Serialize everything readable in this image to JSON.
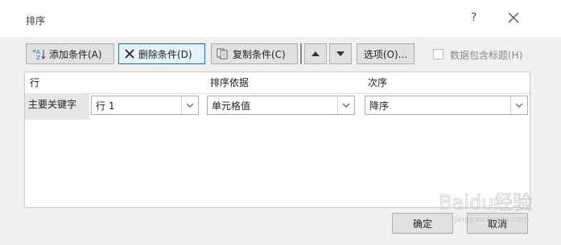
{
  "window": {
    "title": "排序",
    "help_label": "?"
  },
  "toolbar": {
    "add_label": "添加条件(A)",
    "delete_label": "删除条件(D)",
    "copy_label": "复制条件(C)",
    "options_label": "选项(O)...",
    "header_checkbox_label": "数据包含标题(H)",
    "header_checkbox_checked": false
  },
  "grid": {
    "columns": [
      "行",
      "排序依据",
      "次序"
    ],
    "rows": [
      {
        "key_label": "主要关键字",
        "row_value": "行 1",
        "sort_on": "单元格值",
        "order": "降序"
      }
    ]
  },
  "footer": {
    "ok_label": "确定",
    "cancel_label": "取消"
  },
  "watermark": {
    "text": "Baidu经验",
    "url": "jingyan.baidu.com"
  },
  "colors": {
    "accent": "#0078d7",
    "dialog_bg": "#f0f0f0"
  }
}
